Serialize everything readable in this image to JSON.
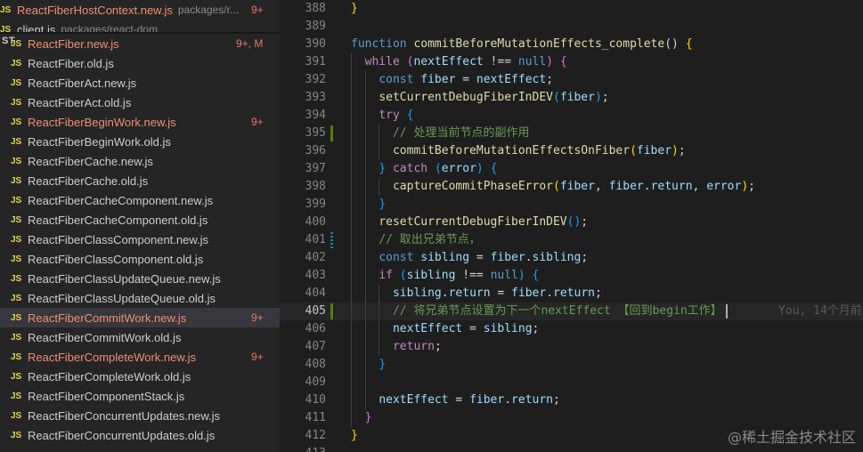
{
  "sidebar": {
    "pinned": [
      {
        "name": "ReactFiberHostContext.new.js",
        "path": "packages/r...",
        "badge": "9+",
        "modified": true
      },
      {
        "name": "client.js",
        "path": "packages/react-dom",
        "badge": "",
        "modified": false
      }
    ],
    "section_stub": "ST",
    "files": [
      {
        "name": "ReactFiber.new.js",
        "badge": "9+, M",
        "modified": true,
        "selected": false
      },
      {
        "name": "ReactFiber.old.js",
        "badge": "",
        "modified": false,
        "selected": false
      },
      {
        "name": "ReactFiberAct.new.js",
        "badge": "",
        "modified": false,
        "selected": false
      },
      {
        "name": "ReactFiberAct.old.js",
        "badge": "",
        "modified": false,
        "selected": false
      },
      {
        "name": "ReactFiberBeginWork.new.js",
        "badge": "9+",
        "modified": true,
        "selected": false
      },
      {
        "name": "ReactFiberBeginWork.old.js",
        "badge": "",
        "modified": false,
        "selected": false
      },
      {
        "name": "ReactFiberCache.new.js",
        "badge": "",
        "modified": false,
        "selected": false
      },
      {
        "name": "ReactFiberCache.old.js",
        "badge": "",
        "modified": false,
        "selected": false
      },
      {
        "name": "ReactFiberCacheComponent.new.js",
        "badge": "",
        "modified": false,
        "selected": false
      },
      {
        "name": "ReactFiberCacheComponent.old.js",
        "badge": "",
        "modified": false,
        "selected": false
      },
      {
        "name": "ReactFiberClassComponent.new.js",
        "badge": "",
        "modified": false,
        "selected": false
      },
      {
        "name": "ReactFiberClassComponent.old.js",
        "badge": "",
        "modified": false,
        "selected": false
      },
      {
        "name": "ReactFiberClassUpdateQueue.new.js",
        "badge": "",
        "modified": false,
        "selected": false
      },
      {
        "name": "ReactFiberClassUpdateQueue.old.js",
        "badge": "",
        "modified": false,
        "selected": false
      },
      {
        "name": "ReactFiberCommitWork.new.js",
        "badge": "9+",
        "modified": true,
        "selected": true
      },
      {
        "name": "ReactFiberCommitWork.old.js",
        "badge": "",
        "modified": false,
        "selected": false
      },
      {
        "name": "ReactFiberCompleteWork.new.js",
        "badge": "9+",
        "modified": true,
        "selected": false
      },
      {
        "name": "ReactFiberCompleteWork.old.js",
        "badge": "",
        "modified": false,
        "selected": false
      },
      {
        "name": "ReactFiberComponentStack.js",
        "badge": "",
        "modified": false,
        "selected": false
      },
      {
        "name": "ReactFiberConcurrentUpdates.new.js",
        "badge": "",
        "modified": false,
        "selected": false
      },
      {
        "name": "ReactFiberConcurrentUpdates.old.js",
        "badge": "",
        "modified": false,
        "selected": false
      }
    ],
    "js_label": "JS"
  },
  "editor": {
    "lines": [
      {
        "n": "388",
        "tokens": [
          [
            "}",
            "brace1"
          ]
        ]
      },
      {
        "n": "389",
        "tokens": []
      },
      {
        "n": "390",
        "tokens": [
          [
            "function",
            "kw"
          ],
          [
            " ",
            "punc"
          ],
          [
            "commitBeforeMutationEffects_complete",
            "fn"
          ],
          [
            "() ",
            "punc"
          ],
          [
            "{",
            "brace1"
          ]
        ]
      },
      {
        "n": "391",
        "tokens": [
          [
            "  ",
            "punc"
          ],
          [
            "while",
            "ctl"
          ],
          [
            " ",
            "punc"
          ],
          [
            "(",
            "brace2"
          ],
          [
            "nextEffect",
            "var"
          ],
          [
            " !== ",
            "punc"
          ],
          [
            "null",
            "kw"
          ],
          [
            ")",
            "brace2"
          ],
          [
            " ",
            "punc"
          ],
          [
            "{",
            "brace2"
          ]
        ]
      },
      {
        "n": "392",
        "tokens": [
          [
            "    ",
            "punc"
          ],
          [
            "const",
            "kw"
          ],
          [
            " ",
            "punc"
          ],
          [
            "fiber",
            "var"
          ],
          [
            " = ",
            "punc"
          ],
          [
            "nextEffect",
            "var"
          ],
          [
            ";",
            "punc"
          ]
        ]
      },
      {
        "n": "393",
        "tokens": [
          [
            "    ",
            "punc"
          ],
          [
            "setCurrentDebugFiberInDEV",
            "fn"
          ],
          [
            "(",
            "brace3"
          ],
          [
            "fiber",
            "var"
          ],
          [
            ")",
            "brace3"
          ],
          [
            ";",
            "punc"
          ]
        ]
      },
      {
        "n": "394",
        "tokens": [
          [
            "    ",
            "punc"
          ],
          [
            "try",
            "ctl"
          ],
          [
            " ",
            "punc"
          ],
          [
            "{",
            "brace3"
          ]
        ]
      },
      {
        "n": "395",
        "tokens": [
          [
            "      ",
            "punc"
          ],
          [
            "// 处理当前节点的副作用",
            "cmt"
          ]
        ],
        "mark": "green"
      },
      {
        "n": "396",
        "tokens": [
          [
            "      ",
            "punc"
          ],
          [
            "commitBeforeMutationEffectsOnFiber",
            "fn"
          ],
          [
            "(",
            "brace1"
          ],
          [
            "fiber",
            "var"
          ],
          [
            ")",
            "brace1"
          ],
          [
            ";",
            "punc"
          ]
        ]
      },
      {
        "n": "397",
        "tokens": [
          [
            "    ",
            "punc"
          ],
          [
            "}",
            "brace3"
          ],
          [
            " ",
            "punc"
          ],
          [
            "catch",
            "ctl"
          ],
          [
            " ",
            "punc"
          ],
          [
            "(",
            "brace3"
          ],
          [
            "error",
            "var"
          ],
          [
            ")",
            "brace3"
          ],
          [
            " ",
            "punc"
          ],
          [
            "{",
            "brace3"
          ]
        ]
      },
      {
        "n": "398",
        "tokens": [
          [
            "      ",
            "punc"
          ],
          [
            "captureCommitPhaseError",
            "fn"
          ],
          [
            "(",
            "brace1"
          ],
          [
            "fiber",
            "var"
          ],
          [
            ", ",
            "punc"
          ],
          [
            "fiber",
            "var"
          ],
          [
            ".",
            "punc"
          ],
          [
            "return",
            "var"
          ],
          [
            ", ",
            "punc"
          ],
          [
            "error",
            "var"
          ],
          [
            ")",
            "brace1"
          ],
          [
            ";",
            "punc"
          ]
        ]
      },
      {
        "n": "399",
        "tokens": [
          [
            "    ",
            "punc"
          ],
          [
            "}",
            "brace3"
          ]
        ]
      },
      {
        "n": "400",
        "tokens": [
          [
            "    ",
            "punc"
          ],
          [
            "resetCurrentDebugFiberInDEV",
            "fn"
          ],
          [
            "()",
            "brace3"
          ],
          [
            ";",
            "punc"
          ]
        ]
      },
      {
        "n": "401",
        "tokens": [
          [
            "    ",
            "punc"
          ],
          [
            "// 取出兄弟节点，",
            "cmt"
          ]
        ],
        "mark": "dotted"
      },
      {
        "n": "402",
        "tokens": [
          [
            "    ",
            "punc"
          ],
          [
            "const",
            "kw"
          ],
          [
            " ",
            "punc"
          ],
          [
            "sibling",
            "var"
          ],
          [
            " = ",
            "punc"
          ],
          [
            "fiber",
            "var"
          ],
          [
            ".",
            "punc"
          ],
          [
            "sibling",
            "var"
          ],
          [
            ";",
            "punc"
          ]
        ]
      },
      {
        "n": "403",
        "tokens": [
          [
            "    ",
            "punc"
          ],
          [
            "if",
            "ctl"
          ],
          [
            " ",
            "punc"
          ],
          [
            "(",
            "brace3"
          ],
          [
            "sibling",
            "var"
          ],
          [
            " !== ",
            "punc"
          ],
          [
            "null",
            "kw"
          ],
          [
            ")",
            "brace3"
          ],
          [
            " ",
            "punc"
          ],
          [
            "{",
            "brace3"
          ]
        ]
      },
      {
        "n": "404",
        "tokens": [
          [
            "      ",
            "punc"
          ],
          [
            "sibling",
            "var"
          ],
          [
            ".",
            "punc"
          ],
          [
            "return",
            "var"
          ],
          [
            " = ",
            "punc"
          ],
          [
            "fiber",
            "var"
          ],
          [
            ".",
            "punc"
          ],
          [
            "return",
            "var"
          ],
          [
            ";",
            "punc"
          ]
        ]
      },
      {
        "n": "405",
        "tokens": [
          [
            "      ",
            "punc"
          ],
          [
            "// 将兄弟节点设置为下一个nextEffect 【回到begin工作】",
            "cmt"
          ]
        ],
        "mark": "green",
        "current": true,
        "blame": "You, 14个月前"
      },
      {
        "n": "406",
        "tokens": [
          [
            "      ",
            "punc"
          ],
          [
            "nextEffect",
            "var"
          ],
          [
            " = ",
            "punc"
          ],
          [
            "sibling",
            "var"
          ],
          [
            ";",
            "punc"
          ]
        ]
      },
      {
        "n": "407",
        "tokens": [
          [
            "      ",
            "punc"
          ],
          [
            "return",
            "ctl"
          ],
          [
            ";",
            "punc"
          ]
        ]
      },
      {
        "n": "408",
        "tokens": [
          [
            "    ",
            "punc"
          ],
          [
            "}",
            "brace3"
          ]
        ]
      },
      {
        "n": "409",
        "tokens": []
      },
      {
        "n": "410",
        "tokens": [
          [
            "    ",
            "punc"
          ],
          [
            "nextEffect",
            "var"
          ],
          [
            " = ",
            "punc"
          ],
          [
            "fiber",
            "var"
          ],
          [
            ".",
            "punc"
          ],
          [
            "return",
            "var"
          ],
          [
            ";",
            "punc"
          ]
        ]
      },
      {
        "n": "411",
        "tokens": [
          [
            "  ",
            "punc"
          ],
          [
            "}",
            "brace2"
          ]
        ]
      },
      {
        "n": "412",
        "tokens": [
          [
            "}",
            "brace1"
          ]
        ]
      },
      {
        "n": "413",
        "tokens": []
      }
    ]
  },
  "watermark": "@稀土掘金技术社区"
}
